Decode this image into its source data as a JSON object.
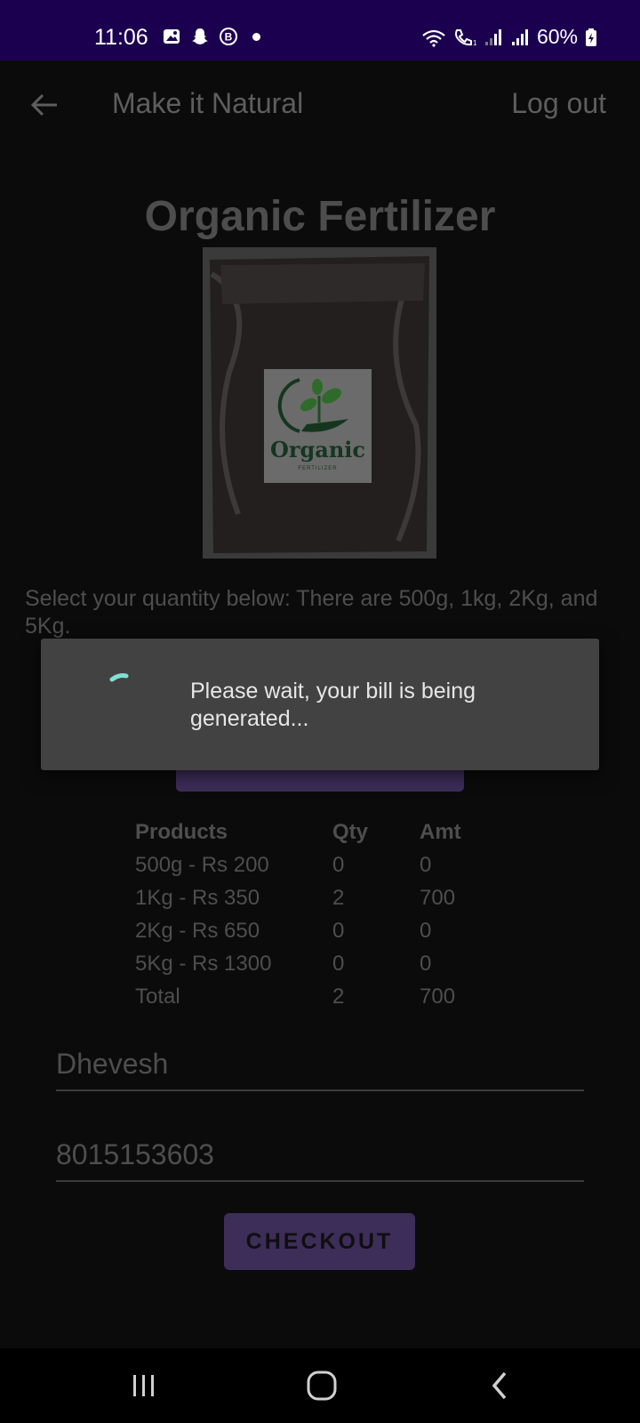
{
  "status_bar": {
    "time": "11:06",
    "battery": "60%",
    "left_icons": [
      "gallery-icon",
      "snapchat-icon",
      "b-circle-icon",
      "dot-icon"
    ],
    "right_icons": [
      "wifi-call-icon",
      "volte-icon",
      "signal-icon",
      "signal-icon",
      "battery-charging-icon"
    ]
  },
  "appbar": {
    "title": "Make it Natural",
    "logout_label": "Log out",
    "back_icon": "arrow-left-icon"
  },
  "product": {
    "title": "Organic Fertilizer",
    "image_label": "Organic",
    "image_sublabel": "FERTILIZER"
  },
  "instructions": "Select your quantity below: There are 500g, 1kg, 2Kg, and 5Kg.",
  "bill": {
    "headers": [
      "Products",
      "Qty",
      "Amt"
    ],
    "rows": [
      [
        "500g - Rs 200",
        "0",
        "0"
      ],
      [
        "1Kg - Rs 350",
        "2",
        "700"
      ],
      [
        "2Kg - Rs 650",
        "0",
        "0"
      ],
      [
        "5Kg - Rs 1300",
        "0",
        "0"
      ],
      [
        "Total",
        "2",
        "700"
      ]
    ]
  },
  "form": {
    "name_value": "Dhevesh",
    "phone_value": "8015153603"
  },
  "checkout_label": "CHECKOUT",
  "dialog": {
    "message": "Please wait, your bill is being generated..."
  },
  "colors": {
    "status_bar": "#1c0050",
    "button": "#3d2d59",
    "spinner": "#7fe0d6",
    "dialog_bg": "#424242"
  },
  "nav_icons": [
    "recents-icon",
    "home-icon",
    "back-icon"
  ]
}
